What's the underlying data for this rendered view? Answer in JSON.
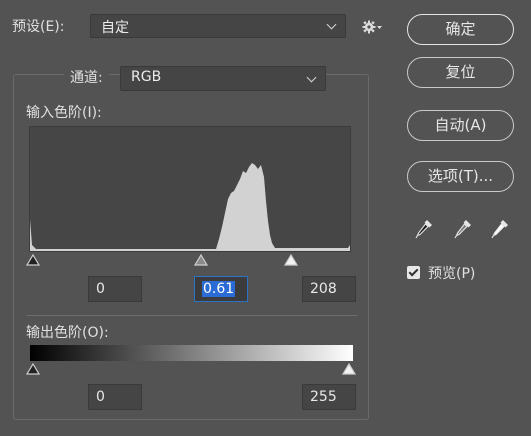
{
  "preset": {
    "label": "预设(E):",
    "value": "自定"
  },
  "channel": {
    "label": "通道:",
    "value": "RGB"
  },
  "input_levels": {
    "label": "输入色阶(I):",
    "black": "0",
    "gamma": "0.61",
    "white": "208"
  },
  "output_levels": {
    "label": "输出色阶(O):",
    "black": "0",
    "white": "255"
  },
  "buttons": {
    "ok": "确定",
    "reset": "复位",
    "auto": "自动(A)",
    "options": "选项(T)..."
  },
  "preview": {
    "label": "预览(P)",
    "checked": true
  },
  "icons": {
    "settings": "gear-icon",
    "black_eyedropper": "eyedropper-black-icon",
    "gray_eyedropper": "eyedropper-gray-icon",
    "white_eyedropper": "eyedropper-white-icon"
  }
}
